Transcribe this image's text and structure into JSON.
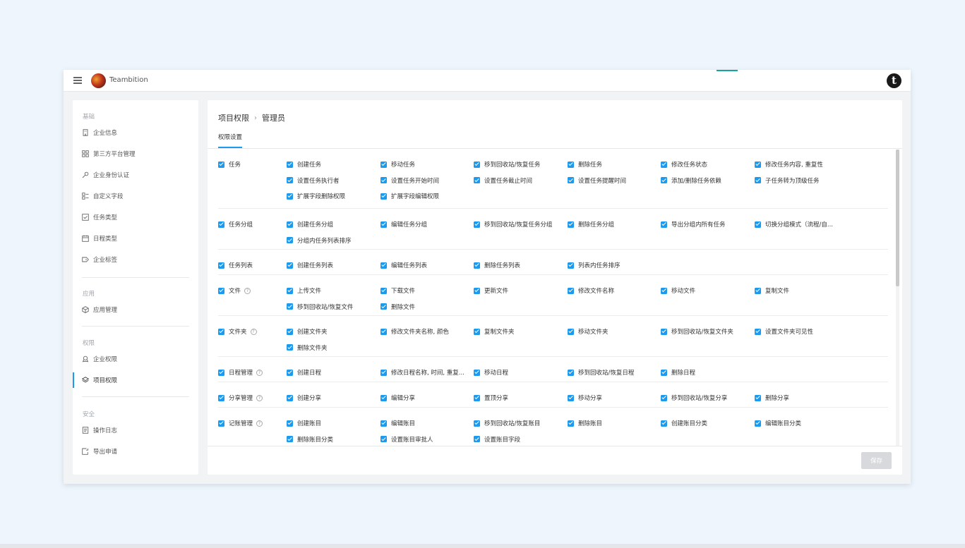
{
  "app": {
    "name": "Teambition",
    "brand_letter": "t"
  },
  "sidebar": {
    "sections": [
      {
        "title": "基础",
        "items": [
          "企业信息",
          "第三方平台管理",
          "企业身份认证",
          "自定义字段",
          "任务类型",
          "日程类型",
          "企业标签"
        ]
      },
      {
        "title": "应用",
        "items": [
          "应用管理"
        ]
      },
      {
        "title": "权限",
        "items": [
          "企业权限",
          "项目权限"
        ]
      },
      {
        "title": "安全",
        "items": [
          "操作日志",
          "导出申请"
        ]
      }
    ],
    "active_item": "项目权限"
  },
  "breadcrumb": {
    "parent": "项目权限",
    "separator": "›",
    "current": "管理员"
  },
  "tabs": [
    "权限设置"
  ],
  "permissions": [
    {
      "category": "任务",
      "help": false,
      "options": [
        "创建任务",
        "移动任务",
        "移到回收站/恢复任务",
        "删除任务",
        "修改任务状态",
        "修改任务内容, 重复性",
        "设置任务执行者",
        "设置任务开始时间",
        "设置任务截止时间",
        "设置任务提醒时间",
        "添加/删除任务依赖",
        "子任务转为顶级任务",
        "扩展字段删除权限",
        "扩展字段编辑权限"
      ]
    },
    {
      "category": "任务分组",
      "help": false,
      "options": [
        "创建任务分组",
        "编辑任务分组",
        "移到回收站/恢复任务分组",
        "删除任务分组",
        "导出分组内所有任务",
        "切换分组模式（流程/自...",
        "分组内任务列表排序"
      ]
    },
    {
      "category": "任务列表",
      "help": false,
      "options": [
        "创建任务列表",
        "编辑任务列表",
        "删除任务列表",
        "列表内任务排序"
      ]
    },
    {
      "category": "文件",
      "help": true,
      "options": [
        "上传文件",
        "下载文件",
        "更新文件",
        "修改文件名称",
        "移动文件",
        "复制文件",
        "移到回收站/恢复文件",
        "删除文件"
      ]
    },
    {
      "category": "文件夹",
      "help": true,
      "options": [
        "创建文件夹",
        "修改文件夹名称, 颜色",
        "复制文件夹",
        "移动文件夹",
        "移到回收站/恢复文件夹",
        "设置文件夹可见性",
        "删除文件夹"
      ]
    },
    {
      "category": "日程管理",
      "help": true,
      "options": [
        "创建日程",
        "修改日程名称, 时间, 重复...",
        "移动日程",
        "移到回收站/恢复日程",
        "删除日程"
      ]
    },
    {
      "category": "分享管理",
      "help": true,
      "options": [
        "创建分享",
        "编辑分享",
        "置顶分享",
        "移动分享",
        "移到回收站/恢复分享",
        "删除分享"
      ]
    },
    {
      "category": "记账管理",
      "help": true,
      "options": [
        "创建账目",
        "编辑账目",
        "移到回收站/恢复账目",
        "删除账目",
        "创建账目分类",
        "编辑账目分类",
        "删除账目分类",
        "设置账目审批人",
        "设置账目字段"
      ]
    }
  ],
  "footer": {
    "save_label": "保存"
  },
  "colors": {
    "accent": "#1b9aee",
    "teal": "#1aa39a",
    "page_bg": "#eef5fd",
    "disabled_btn": "#d7d9dc"
  }
}
